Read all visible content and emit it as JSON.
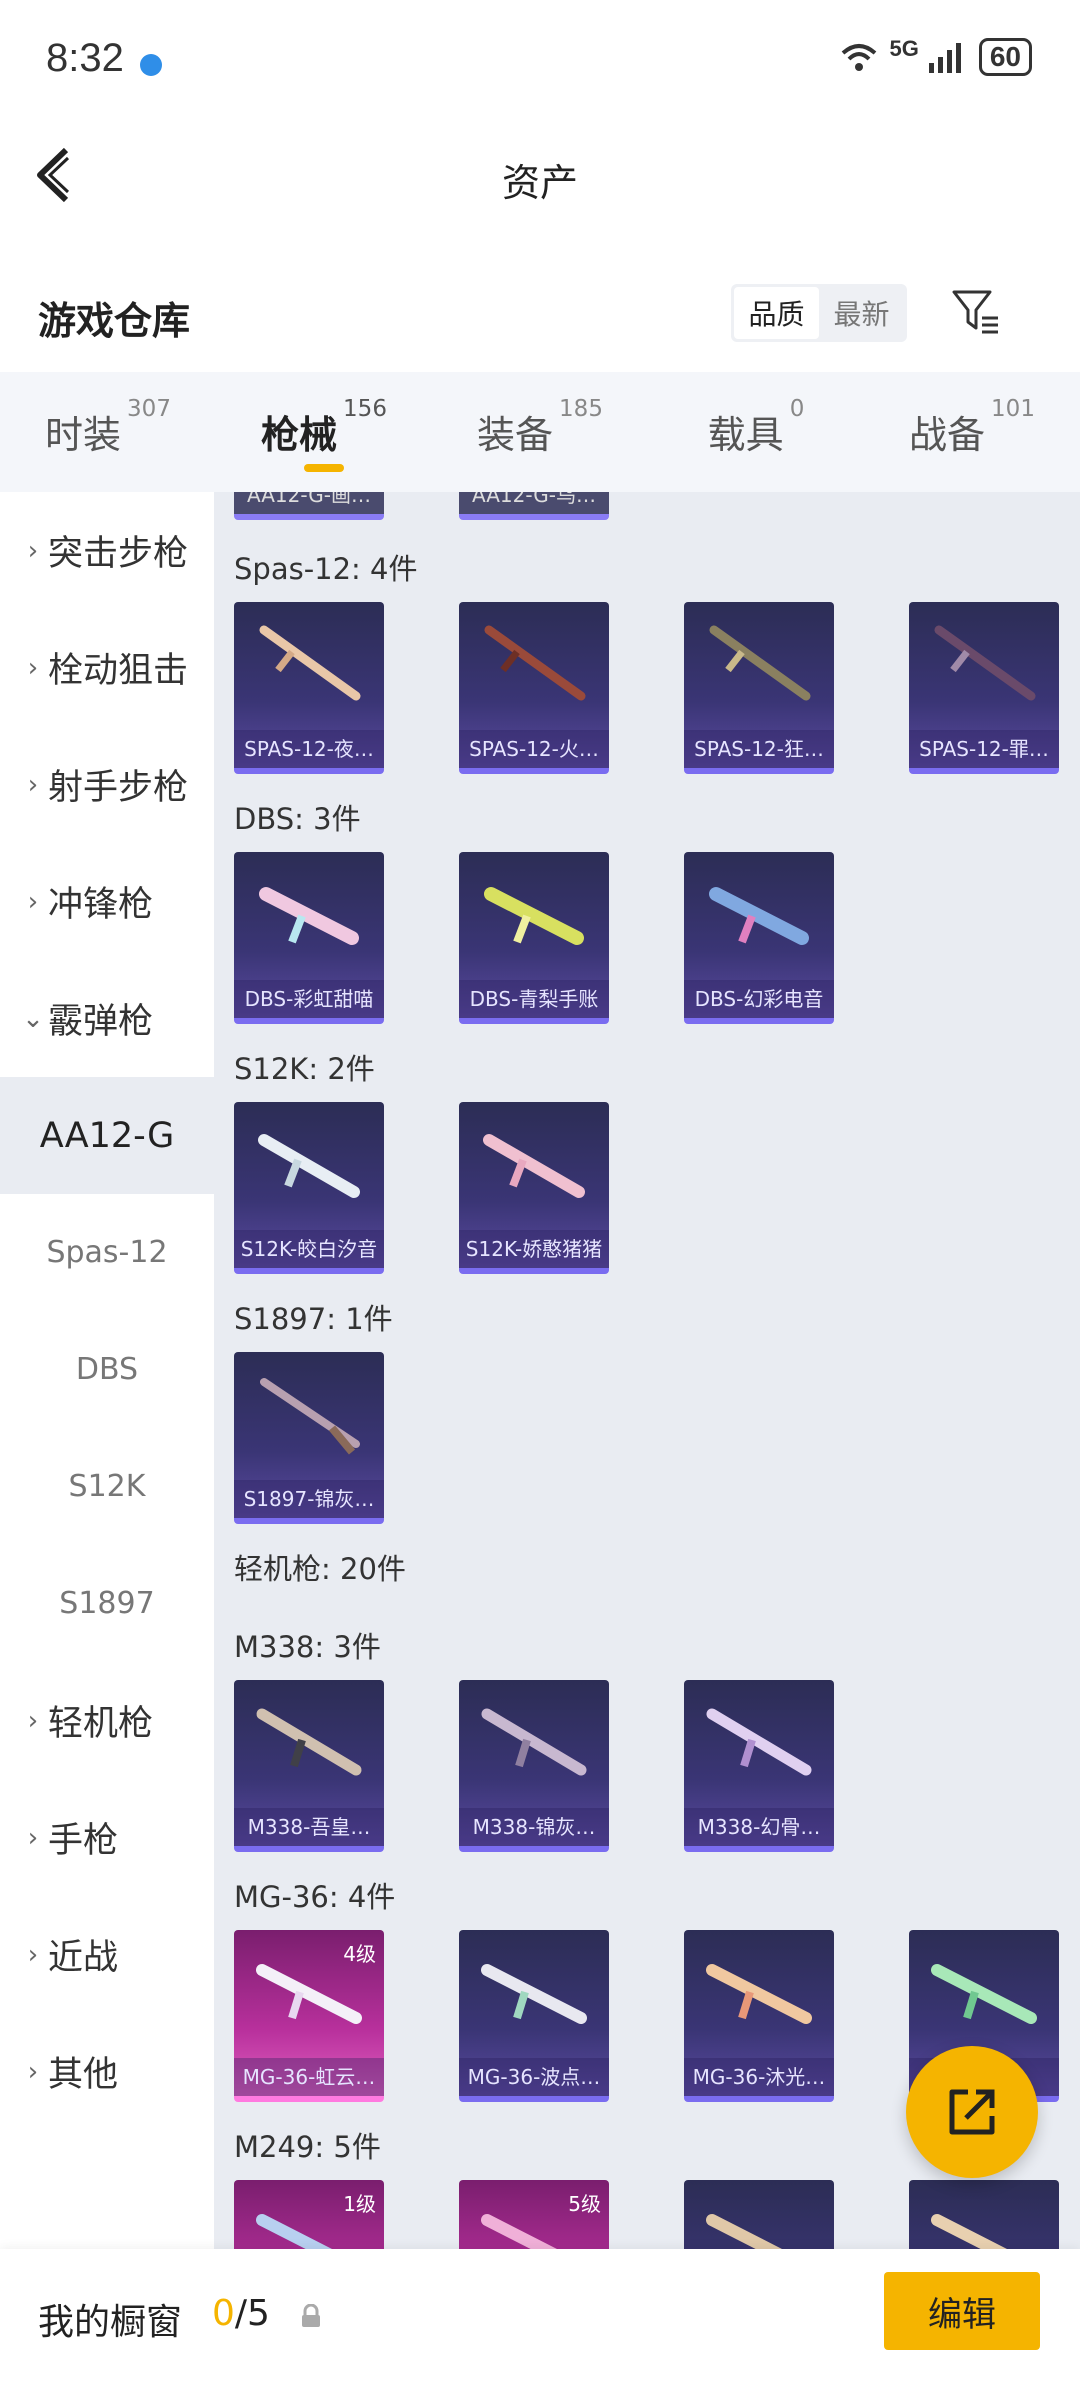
{
  "status": {
    "time": "8:32",
    "network": "5G",
    "battery": "60"
  },
  "header": {
    "title": "资产"
  },
  "section": {
    "title": "游戏仓库",
    "sort_options": [
      "品质",
      "最新"
    ]
  },
  "tabs": [
    {
      "label": "时装",
      "count": "307"
    },
    {
      "label": "枪械",
      "count": "156"
    },
    {
      "label": "装备",
      "count": "185"
    },
    {
      "label": "载具",
      "count": "0"
    },
    {
      "label": "战备",
      "count": "101"
    }
  ],
  "sidebar": [
    {
      "label": "突击步枪",
      "chevron": "›"
    },
    {
      "label": "栓动狙击",
      "chevron": "›"
    },
    {
      "label": "射手步枪",
      "chevron": "›"
    },
    {
      "label": "冲锋枪",
      "chevron": "›"
    },
    {
      "label": "霰弹枪",
      "chevron": "⌄"
    },
    {
      "label": "AA12-G"
    },
    {
      "label": "Spas-12"
    },
    {
      "label": "DBS"
    },
    {
      "label": "S12K"
    },
    {
      "label": "S1897"
    },
    {
      "label": "轻机枪",
      "chevron": "›"
    },
    {
      "label": "手枪",
      "chevron": "›"
    },
    {
      "label": "近战",
      "chevron": "›"
    },
    {
      "label": "其他",
      "chevron": "›"
    }
  ],
  "groups": [
    {
      "label": "Spas-12: 4件"
    },
    {
      "label": "DBS: 3件"
    },
    {
      "label": "S12K: 2件"
    },
    {
      "label": "S1897: 1件"
    },
    {
      "label": "轻机枪: 20件"
    },
    {
      "label": "M338: 3件"
    },
    {
      "label": "MG-36: 4件"
    },
    {
      "label": "M249: 5件"
    }
  ],
  "cards": [
    {
      "name": "AA12-G-画…"
    },
    {
      "name": "AA12-G-乌…"
    },
    {
      "name": "SPAS-12-夜…"
    },
    {
      "name": "SPAS-12-火…"
    },
    {
      "name": "SPAS-12-狂…"
    },
    {
      "name": "SPAS-12-罪…"
    },
    {
      "name": "DBS-彩虹甜喵"
    },
    {
      "name": "DBS-青梨手账"
    },
    {
      "name": "DBS-幻彩电音"
    },
    {
      "name": "S12K-皎白汐音"
    },
    {
      "name": "S12K-娇憨猪猪"
    },
    {
      "name": "S1897-锦灰…"
    },
    {
      "name": "M338-吾皇…"
    },
    {
      "name": "M338-锦灰…"
    },
    {
      "name": "M338-幻骨…"
    },
    {
      "name": "MG-36-虹云…",
      "level": "4级"
    },
    {
      "name": "MG-36-波点…"
    },
    {
      "name": "MG-36-沐光…"
    },
    {
      "name": ""
    },
    {
      "name": "",
      "level": "1级"
    },
    {
      "name": "",
      "level": "5级"
    },
    {
      "name": ""
    },
    {
      "name": ""
    }
  ],
  "bottom": {
    "label": "我的橱窗",
    "current": "0",
    "total": "/5",
    "edit": "编辑"
  },
  "colors": {
    "accent": "#f5b400",
    "card_dark": "#2c2d55",
    "card_pink": "#b8309c"
  }
}
